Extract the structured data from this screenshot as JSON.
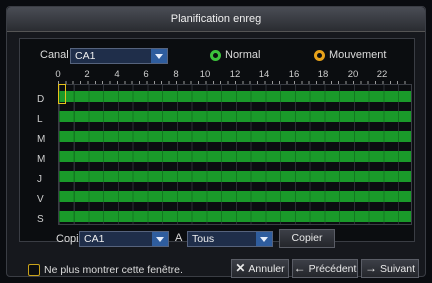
{
  "window": {
    "title": "Planification enreg"
  },
  "channel": {
    "label": "Canal",
    "value": "CA1"
  },
  "modes": {
    "normal": "Normal",
    "motion": "Mouvement",
    "normal_color": "#3cc23c",
    "motion_color": "#e8a21a"
  },
  "hours": [
    "0",
    "2",
    "4",
    "6",
    "8",
    "10",
    "12",
    "14",
    "16",
    "18",
    "20",
    "22"
  ],
  "days": [
    "D",
    "L",
    "M",
    "M",
    "J",
    "V",
    "S"
  ],
  "schedule_color": "#1a9a2a",
  "copy": {
    "label": "Copier",
    "source": "CA1",
    "to_label": "A",
    "target": "Tous",
    "button": "Copier"
  },
  "footer": {
    "dont_show": "Ne plus montrer cette fenêtre.",
    "cancel": "Annuler",
    "previous": "Précédent",
    "next": "Suivant"
  }
}
